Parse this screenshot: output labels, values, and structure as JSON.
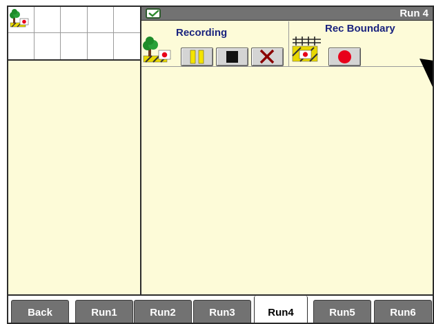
{
  "header": {
    "title": "Run 4"
  },
  "recording": {
    "label": "Recording",
    "buttons": [
      {
        "name": "pause",
        "icon": "pause-icon"
      },
      {
        "name": "stop",
        "icon": "stop-icon"
      },
      {
        "name": "cancel",
        "icon": "close-icon"
      }
    ]
  },
  "boundary": {
    "label": "Rec Boundary",
    "record_button_icon": "record-icon"
  },
  "tabs": [
    {
      "label": "Back",
      "active": false
    },
    {
      "label": "Run1",
      "active": false
    },
    {
      "label": "Run2",
      "active": false
    },
    {
      "label": "Run3",
      "active": false
    },
    {
      "label": "Run4",
      "active": true
    },
    {
      "label": "Run5",
      "active": false
    },
    {
      "label": "Run6",
      "active": false
    }
  ],
  "colors": {
    "background": "#fdfbd8",
    "header": "#727272",
    "label": "#1a237e",
    "record": "#e8001a",
    "pause": "#f5e400"
  }
}
